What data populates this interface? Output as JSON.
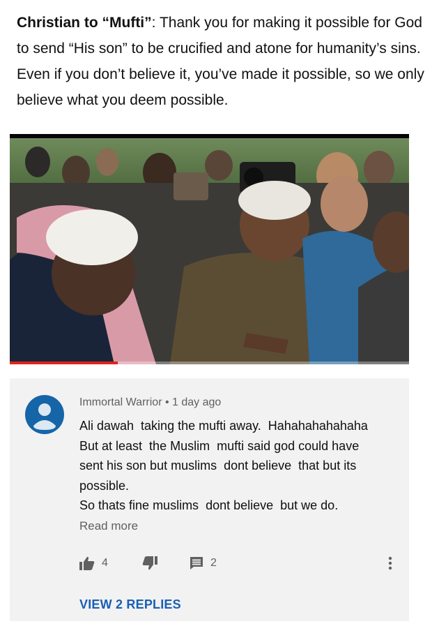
{
  "caption": {
    "speaker": "Christian to “Mufti”",
    "text": ": Thank you for making it possible for God to send “His son” to be crucified and atone for humanity’s sins. Even if you don’t believe it, you’ve made it possible, so we only believe what you deem possible."
  },
  "video": {
    "progress": 0.27,
    "colors": {
      "progress": "#e2231a"
    }
  },
  "comment": {
    "author": "Immortal Warrior",
    "separator": "•",
    "time": "1 day ago",
    "lines": [
      "Ali dawah  taking the mufti away.  Hahahahahahaha",
      "But at least  the Muslim  mufti said god could have",
      "sent his son but muslims  dont believe  that but its",
      "possible.",
      "So thats fine muslims  dont believe  but we do."
    ],
    "read_more": "Read more",
    "likes": "4",
    "replies_count": "2",
    "view_replies": "VIEW 2 REPLIES",
    "icons": [
      "avatar-icon",
      "thumbs-up-icon",
      "thumbs-down-icon",
      "reply-icon",
      "more-vert-icon"
    ],
    "colors": {
      "avatar": "#1565a8",
      "link": "#1a5fb4"
    }
  }
}
